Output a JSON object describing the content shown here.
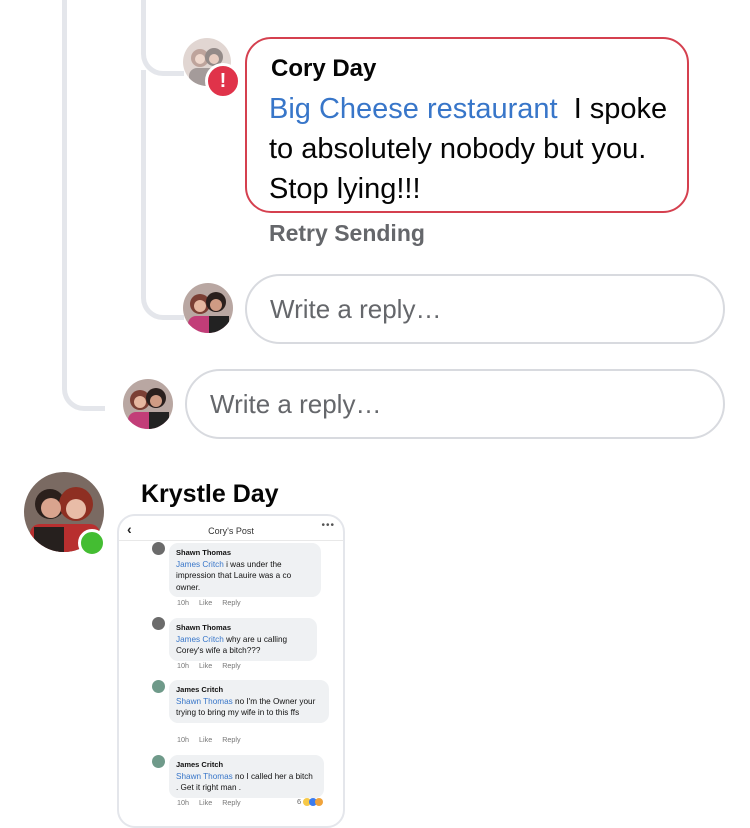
{
  "comment": {
    "author": "Cory Day",
    "mention": "Big Cheese restaurant",
    "text": "I spoke to absolutely nobody but you. Stop lying!!!",
    "error_badge": "!",
    "status": "Retry Sending"
  },
  "reply_inner": {
    "placeholder": "Write a reply…"
  },
  "reply_outer": {
    "placeholder": "Write a reply…"
  },
  "next_comment": {
    "author": "Krystle Day"
  },
  "embedded_post": {
    "title": "Cory's Post",
    "back": "‹",
    "more": "•••",
    "comments": [
      {
        "name": "Shawn Thomas",
        "mention": "James Critch",
        "text": "i was under the impression that Lauire was a co owner.",
        "time": "10h",
        "like": "Like",
        "reply": "Reply"
      },
      {
        "name": "Shawn Thomas",
        "mention": "James Critch",
        "text": "why are u calling Corey's wife a bitch???",
        "time": "10h",
        "like": "Like",
        "reply": "Reply"
      },
      {
        "name": "James Critch",
        "mention": "Shawn Thomas",
        "text": "no I'm the Owner your trying to bring my wife in to this ffs",
        "time": "10h",
        "like": "Like",
        "reply": "Reply"
      },
      {
        "name": "James Critch",
        "mention": "Shawn Thomas",
        "text": "no I called her a bitch . Get it right man .",
        "time": "10h",
        "like": "Like",
        "reply": "Reply",
        "reactions": "6"
      }
    ]
  },
  "colors": {
    "error": "#d5404f",
    "link": "#3876c9",
    "online": "#44bd32",
    "muted": "#65676b"
  }
}
